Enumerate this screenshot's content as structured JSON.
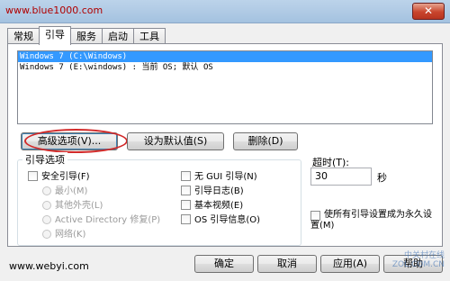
{
  "window": {
    "title_watermark": "www.blue1000.com",
    "close_glyph": "✕"
  },
  "tabs": [
    {
      "label": "常规"
    },
    {
      "label": "引导"
    },
    {
      "label": "服务"
    },
    {
      "label": "启动"
    },
    {
      "label": "工具"
    }
  ],
  "os_list": [
    {
      "label": "Windows 7 (C:\\Windows)",
      "selected": true
    },
    {
      "label": "Windows 7 (E:\\windows) : 当前 OS; 默认 OS",
      "selected": false
    }
  ],
  "buttons": {
    "advanced": "高级选项(V)...",
    "set_default": "设为默认值(S)",
    "delete": "删除(D)",
    "ok": "确定",
    "cancel": "取消",
    "apply": "应用(A)",
    "help": "帮助"
  },
  "boot_options": {
    "group_title": "引导选项",
    "safe_boot": "安全引导(F)",
    "minimal": "最小(M)",
    "alternate_shell": "其他外壳(L)",
    "active_directory": "Active Directory 修复(P)",
    "network": "网络(K)",
    "no_gui": "无 GUI 引导(N)",
    "boot_log": "引导日志(B)",
    "base_video": "基本视频(E)",
    "os_boot_info": "OS 引导信息(O)"
  },
  "timeout": {
    "label": "超时(T):",
    "value": "30",
    "unit": "秒"
  },
  "make_permanent": "使所有引导设置成为永久设置(M)",
  "watermarks": {
    "bottom_left": "www.webyi.com",
    "bottom_right_line1": "中关村在线",
    "bottom_right_line2": "ZOL.COM.CN"
  }
}
